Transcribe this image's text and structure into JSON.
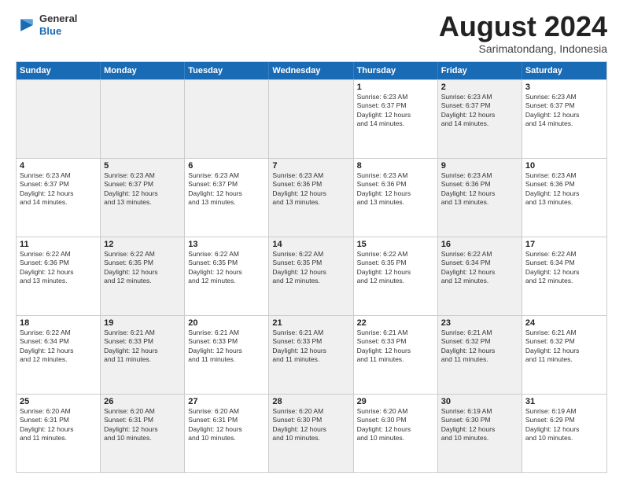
{
  "header": {
    "logo": {
      "general": "General",
      "blue": "Blue"
    },
    "title": "August 2024",
    "location": "Sarimatondang, Indonesia"
  },
  "weekdays": [
    "Sunday",
    "Monday",
    "Tuesday",
    "Wednesday",
    "Thursday",
    "Friday",
    "Saturday"
  ],
  "weeks": [
    [
      {
        "day": "",
        "info": "",
        "shaded": true
      },
      {
        "day": "",
        "info": "",
        "shaded": true
      },
      {
        "day": "",
        "info": "",
        "shaded": true
      },
      {
        "day": "",
        "info": "",
        "shaded": true
      },
      {
        "day": "1",
        "info": "Sunrise: 6:23 AM\nSunset: 6:37 PM\nDaylight: 12 hours\nand 14 minutes."
      },
      {
        "day": "2",
        "info": "Sunrise: 6:23 AM\nSunset: 6:37 PM\nDaylight: 12 hours\nand 14 minutes.",
        "shaded": true
      },
      {
        "day": "3",
        "info": "Sunrise: 6:23 AM\nSunset: 6:37 PM\nDaylight: 12 hours\nand 14 minutes."
      }
    ],
    [
      {
        "day": "4",
        "info": "Sunrise: 6:23 AM\nSunset: 6:37 PM\nDaylight: 12 hours\nand 14 minutes."
      },
      {
        "day": "5",
        "info": "Sunrise: 6:23 AM\nSunset: 6:37 PM\nDaylight: 12 hours\nand 13 minutes.",
        "shaded": true
      },
      {
        "day": "6",
        "info": "Sunrise: 6:23 AM\nSunset: 6:37 PM\nDaylight: 12 hours\nand 13 minutes."
      },
      {
        "day": "7",
        "info": "Sunrise: 6:23 AM\nSunset: 6:36 PM\nDaylight: 12 hours\nand 13 minutes.",
        "shaded": true
      },
      {
        "day": "8",
        "info": "Sunrise: 6:23 AM\nSunset: 6:36 PM\nDaylight: 12 hours\nand 13 minutes."
      },
      {
        "day": "9",
        "info": "Sunrise: 6:23 AM\nSunset: 6:36 PM\nDaylight: 12 hours\nand 13 minutes.",
        "shaded": true
      },
      {
        "day": "10",
        "info": "Sunrise: 6:23 AM\nSunset: 6:36 PM\nDaylight: 12 hours\nand 13 minutes."
      }
    ],
    [
      {
        "day": "11",
        "info": "Sunrise: 6:22 AM\nSunset: 6:36 PM\nDaylight: 12 hours\nand 13 minutes."
      },
      {
        "day": "12",
        "info": "Sunrise: 6:22 AM\nSunset: 6:35 PM\nDaylight: 12 hours\nand 12 minutes.",
        "shaded": true
      },
      {
        "day": "13",
        "info": "Sunrise: 6:22 AM\nSunset: 6:35 PM\nDaylight: 12 hours\nand 12 minutes."
      },
      {
        "day": "14",
        "info": "Sunrise: 6:22 AM\nSunset: 6:35 PM\nDaylight: 12 hours\nand 12 minutes.",
        "shaded": true
      },
      {
        "day": "15",
        "info": "Sunrise: 6:22 AM\nSunset: 6:35 PM\nDaylight: 12 hours\nand 12 minutes."
      },
      {
        "day": "16",
        "info": "Sunrise: 6:22 AM\nSunset: 6:34 PM\nDaylight: 12 hours\nand 12 minutes.",
        "shaded": true
      },
      {
        "day": "17",
        "info": "Sunrise: 6:22 AM\nSunset: 6:34 PM\nDaylight: 12 hours\nand 12 minutes."
      }
    ],
    [
      {
        "day": "18",
        "info": "Sunrise: 6:22 AM\nSunset: 6:34 PM\nDaylight: 12 hours\nand 12 minutes."
      },
      {
        "day": "19",
        "info": "Sunrise: 6:21 AM\nSunset: 6:33 PM\nDaylight: 12 hours\nand 11 minutes.",
        "shaded": true
      },
      {
        "day": "20",
        "info": "Sunrise: 6:21 AM\nSunset: 6:33 PM\nDaylight: 12 hours\nand 11 minutes."
      },
      {
        "day": "21",
        "info": "Sunrise: 6:21 AM\nSunset: 6:33 PM\nDaylight: 12 hours\nand 11 minutes.",
        "shaded": true
      },
      {
        "day": "22",
        "info": "Sunrise: 6:21 AM\nSunset: 6:33 PM\nDaylight: 12 hours\nand 11 minutes."
      },
      {
        "day": "23",
        "info": "Sunrise: 6:21 AM\nSunset: 6:32 PM\nDaylight: 12 hours\nand 11 minutes.",
        "shaded": true
      },
      {
        "day": "24",
        "info": "Sunrise: 6:21 AM\nSunset: 6:32 PM\nDaylight: 12 hours\nand 11 minutes."
      }
    ],
    [
      {
        "day": "25",
        "info": "Sunrise: 6:20 AM\nSunset: 6:31 PM\nDaylight: 12 hours\nand 11 minutes."
      },
      {
        "day": "26",
        "info": "Sunrise: 6:20 AM\nSunset: 6:31 PM\nDaylight: 12 hours\nand 10 minutes.",
        "shaded": true
      },
      {
        "day": "27",
        "info": "Sunrise: 6:20 AM\nSunset: 6:31 PM\nDaylight: 12 hours\nand 10 minutes."
      },
      {
        "day": "28",
        "info": "Sunrise: 6:20 AM\nSunset: 6:30 PM\nDaylight: 12 hours\nand 10 minutes.",
        "shaded": true
      },
      {
        "day": "29",
        "info": "Sunrise: 6:20 AM\nSunset: 6:30 PM\nDaylight: 12 hours\nand 10 minutes."
      },
      {
        "day": "30",
        "info": "Sunrise: 6:19 AM\nSunset: 6:30 PM\nDaylight: 12 hours\nand 10 minutes.",
        "shaded": true
      },
      {
        "day": "31",
        "info": "Sunrise: 6:19 AM\nSunset: 6:29 PM\nDaylight: 12 hours\nand 10 minutes."
      }
    ]
  ]
}
